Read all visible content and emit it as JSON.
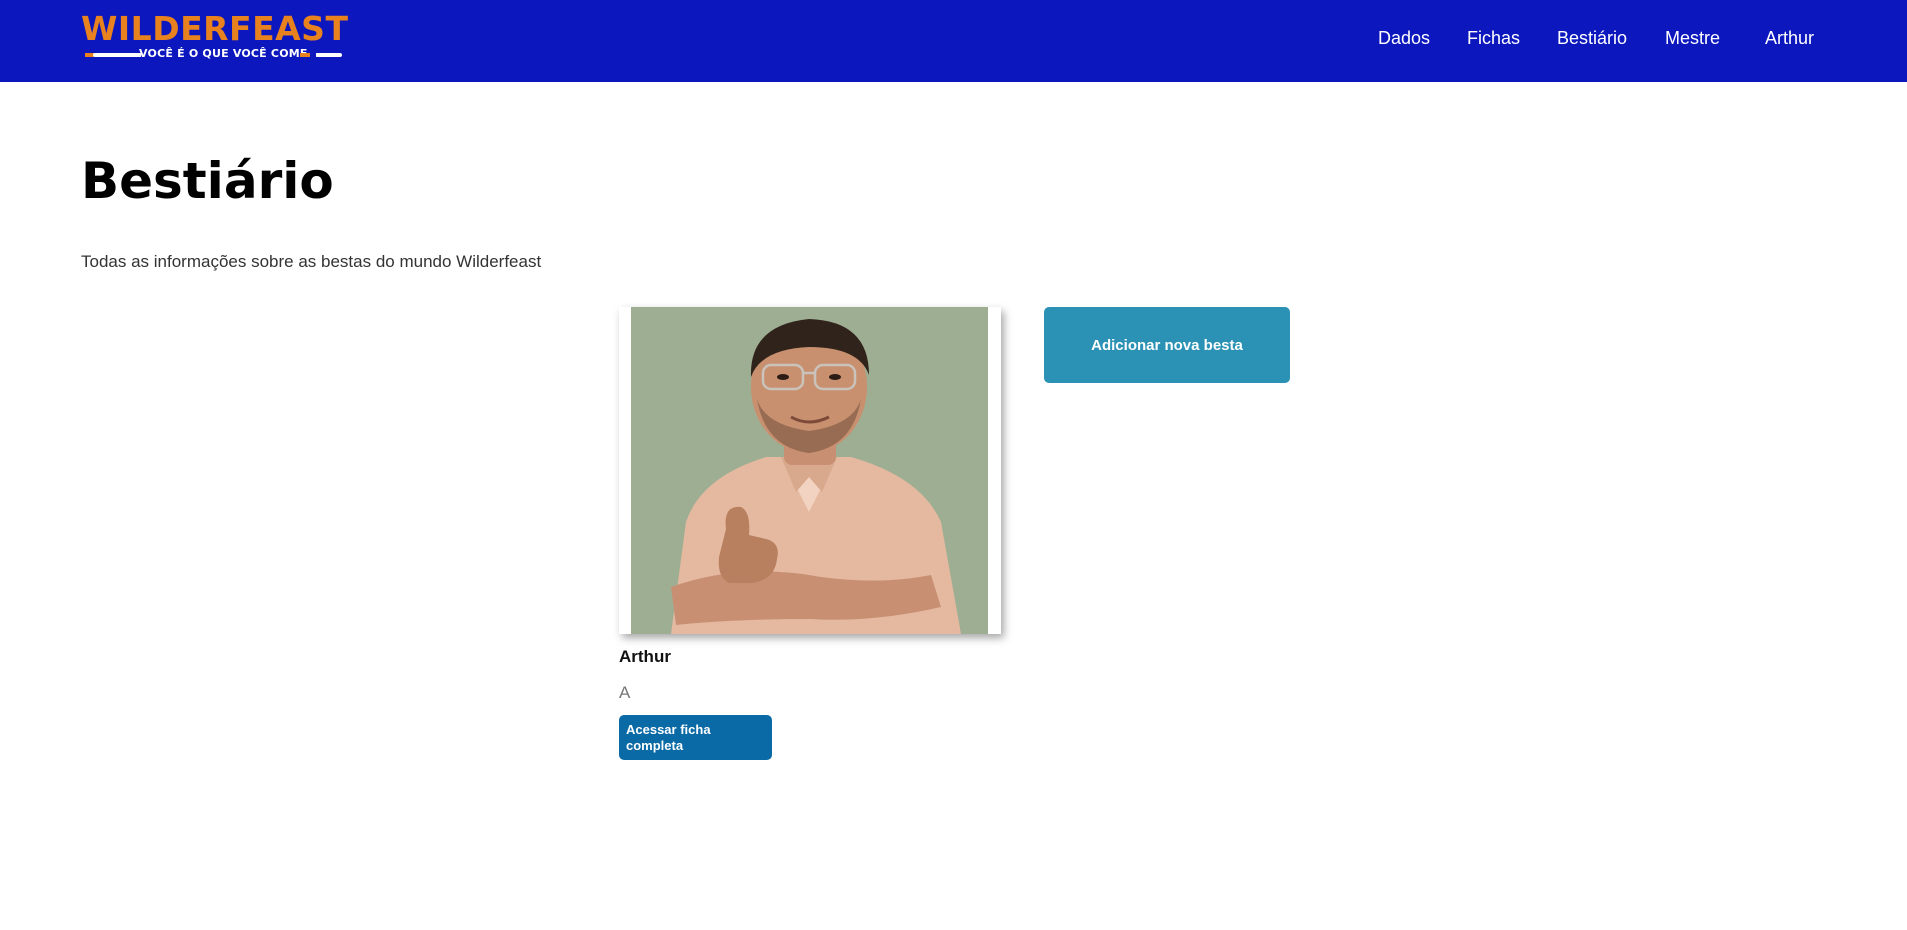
{
  "navbar": {
    "logo": {
      "title": "WILDERFEAST",
      "tagline": "VOCÊ É O QUE VOCÊ COME"
    },
    "links": [
      "Dados",
      "Fichas",
      "Bestiário",
      "Mestre",
      "Arthur"
    ]
  },
  "main": {
    "title": "Bestiário",
    "description": "Todas as informações sobre as bestas do mundo Wilderfeast",
    "add_button_label": "Adicionar nova besta",
    "cards": [
      {
        "name": "Arthur",
        "subtitle": "A",
        "button_label": "Acessar ficha completa"
      }
    ]
  },
  "colors": {
    "navbar_bg": "#0c17bd",
    "logo_orange": "#e8821e",
    "card_button": "#0a6aa6",
    "add_button": "#2b92b5"
  }
}
